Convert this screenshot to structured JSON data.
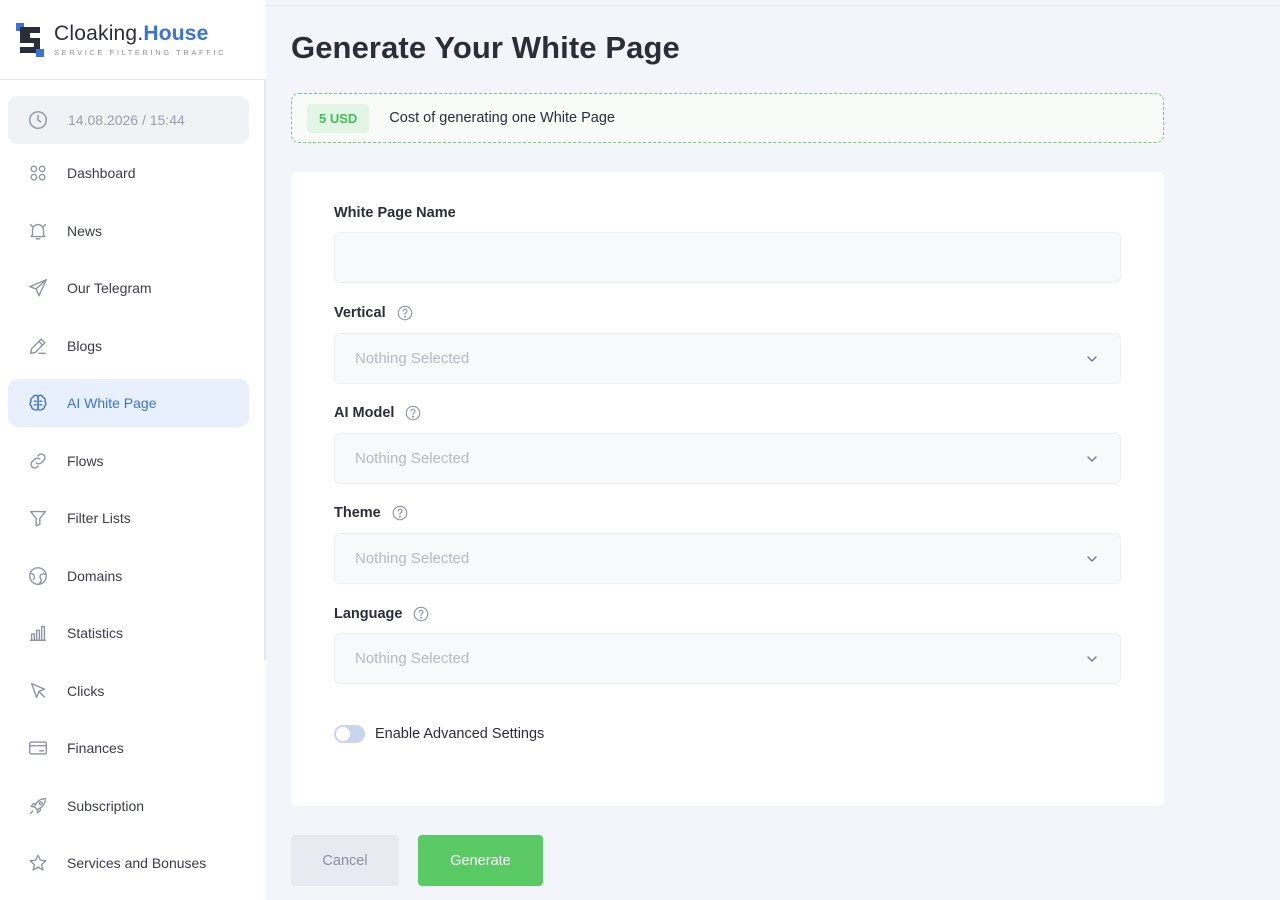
{
  "brand": {
    "name_part1": "Cloaking.",
    "name_part2": "House",
    "tagline": "SERVICE FILTERING TRAFFIC",
    "accent_color": "#3a73d6"
  },
  "sidebar": {
    "datetime": "14.08.2026 / 15:44",
    "items": [
      {
        "label": "Dashboard",
        "icon": "grid-icon"
      },
      {
        "label": "News",
        "icon": "bell-icon"
      },
      {
        "label": "Our Telegram",
        "icon": "paper-plane-icon"
      },
      {
        "label": "Blogs",
        "icon": "pencil-icon"
      },
      {
        "label": "AI White Page",
        "icon": "brain-icon",
        "active": true
      },
      {
        "label": "Flows",
        "icon": "link-icon"
      },
      {
        "label": "Filter Lists",
        "icon": "filter-icon"
      },
      {
        "label": "Domains",
        "icon": "globe-icon"
      },
      {
        "label": "Statistics",
        "icon": "bar-chart-icon"
      },
      {
        "label": "Clicks",
        "icon": "cursor-icon"
      },
      {
        "label": "Finances",
        "icon": "wallet-icon"
      },
      {
        "label": "Subscription",
        "icon": "rocket-icon"
      },
      {
        "label": "Services and Bonuses",
        "icon": "star-icon"
      }
    ]
  },
  "main": {
    "title": "Generate Your White Page",
    "cost": {
      "badge": "5 USD",
      "text": "Cost of generating one White Page",
      "border_color": "#6fd27a"
    },
    "form": {
      "name_label": "White Page Name",
      "name_value": "",
      "vertical_label": "Vertical",
      "vertical_value": "Nothing Selected",
      "model_label": "AI Model",
      "model_value": "Nothing Selected",
      "theme_label": "Theme",
      "theme_value": "Nothing Selected",
      "language_label": "Language",
      "language_value": "Nothing Selected",
      "advanced_label": "Enable Advanced Settings",
      "advanced_enabled": false
    },
    "buttons": {
      "cancel": "Cancel",
      "generate": "Generate",
      "generate_color": "#5acb64"
    }
  }
}
